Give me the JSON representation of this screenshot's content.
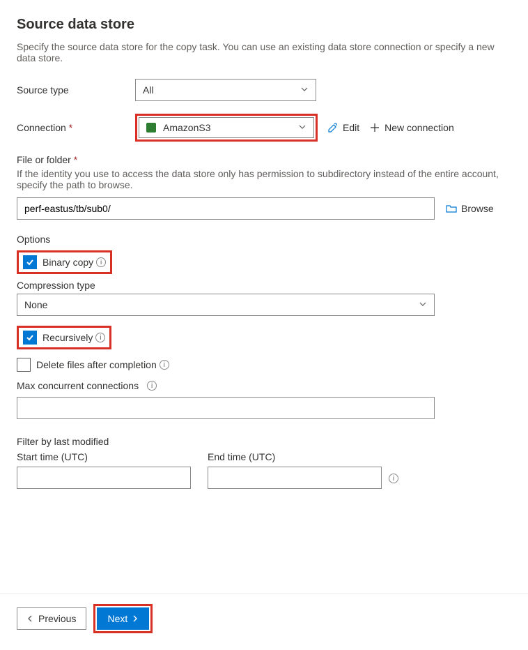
{
  "header": {
    "title": "Source data store",
    "description": "Specify the source data store for the copy task. You can use an existing data store connection or specify a new data store."
  },
  "sourceType": {
    "label": "Source type",
    "value": "All"
  },
  "connection": {
    "label": "Connection",
    "value": "AmazonS3",
    "edit": "Edit",
    "newConnection": "New connection"
  },
  "fileOrFolder": {
    "label": "File or folder",
    "help": "If the identity you use to access the data store only has permission to subdirectory instead of the entire account, specify the path to browse.",
    "value": "perf-eastus/tb/sub0/",
    "browse": "Browse"
  },
  "options": {
    "title": "Options",
    "binaryCopy": {
      "label": "Binary copy",
      "checked": true
    },
    "compression": {
      "label": "Compression type",
      "value": "None"
    },
    "recursively": {
      "label": "Recursively",
      "checked": true
    },
    "deleteAfter": {
      "label": "Delete files after completion",
      "checked": false
    },
    "maxConcurrent": {
      "label": "Max concurrent connections",
      "value": ""
    }
  },
  "filter": {
    "title": "Filter by last modified",
    "startLabel": "Start time (UTC)",
    "endLabel": "End time (UTC)",
    "startValue": "",
    "endValue": ""
  },
  "footer": {
    "previous": "Previous",
    "next": "Next"
  }
}
